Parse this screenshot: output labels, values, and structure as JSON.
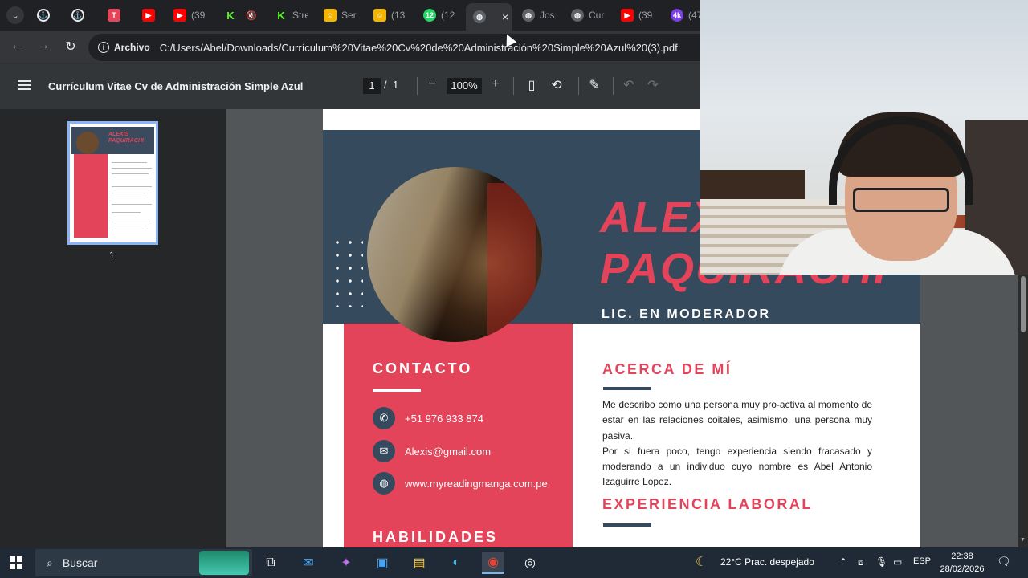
{
  "tabs": [
    {
      "label": "",
      "icon": "account-icon",
      "color": "#202124"
    },
    {
      "label": "",
      "icon": "account-icon",
      "color": "#202124"
    },
    {
      "label": "",
      "icon": "app-icon",
      "color": "#e4445a"
    },
    {
      "label": "",
      "icon": "youtube-icon",
      "color": "#ff0000"
    },
    {
      "label": "(39",
      "icon": "youtube-icon",
      "color": "#ff0000"
    },
    {
      "label": "",
      "icon": "kick-icon",
      "color": "#53fc18"
    },
    {
      "label": "",
      "icon": "mute-icon",
      "color": "#202124"
    },
    {
      "label": "Stre",
      "icon": "kick-icon",
      "color": "#53fc18"
    },
    {
      "label": "Ser",
      "icon": "badge-icon",
      "color": "#f4b400"
    },
    {
      "label": "(13",
      "icon": "badge-icon",
      "color": "#f4b400"
    },
    {
      "label": "(12",
      "icon": "whatsapp-icon",
      "color": "#25d366"
    },
    {
      "label": "",
      "icon": "globe-icon",
      "color": "#5f6368",
      "active": true,
      "close": "×"
    },
    {
      "label": "Jos",
      "icon": "globe-icon",
      "color": "#5f6368"
    },
    {
      "label": "Cur",
      "icon": "globe-icon",
      "color": "#5f6368"
    },
    {
      "label": "(39",
      "icon": "youtube-icon",
      "color": "#ff0000"
    },
    {
      "label": "(47",
      "icon": "avatar-icon",
      "color": "#7b3fe4"
    }
  ],
  "address": {
    "chip": "Archivo",
    "url": "C:/Users/Abel/Downloads/Currículum%20Vitae%20Cv%20de%20Administración%20Simple%20Azul%20(3).pdf"
  },
  "pdf": {
    "title": "Currículum Vitae Cv de Administración Simple Azul",
    "page": "1",
    "page_sep": "/",
    "page_total": "1",
    "zoom": "100%",
    "thumb_label": "1"
  },
  "cv": {
    "name_line1": "ALEXIS",
    "name_line2": "PAQUIRACHI",
    "role": "LIC. EN MODERADOR",
    "contact_heading": "CONTACTO",
    "phone": "+51 976 933 874",
    "email": "Alexis@gmail.com",
    "web": "www.myreadingmanga.com.pe",
    "skills_heading": "HABILIDADES",
    "about_heading": "ACERCA DE MÍ",
    "about_text": "Me describo como una persona muy pro-activa al momento de estar en las relaciones coitales, asimismo. una persona muy pasiva.",
    "about_text2": "Por si fuera poco, tengo experiencia siendo fracasado y moderando a un individuo cuyo nombre es Abel Antonio Izaguirre Lopez.",
    "experience_heading": "EXPERIENCIA LABORAL"
  },
  "thumbnail": {
    "name": "ALEXIS PAQUIRACHI"
  },
  "taskbar": {
    "search_label": "Buscar",
    "weather": "22°C  Prac. despejado",
    "lang": "ESP",
    "time": "22:38",
    "date": "28/02/2026"
  },
  "colors": {
    "accent_red": "#e4445a",
    "navy": "#364a5e"
  }
}
